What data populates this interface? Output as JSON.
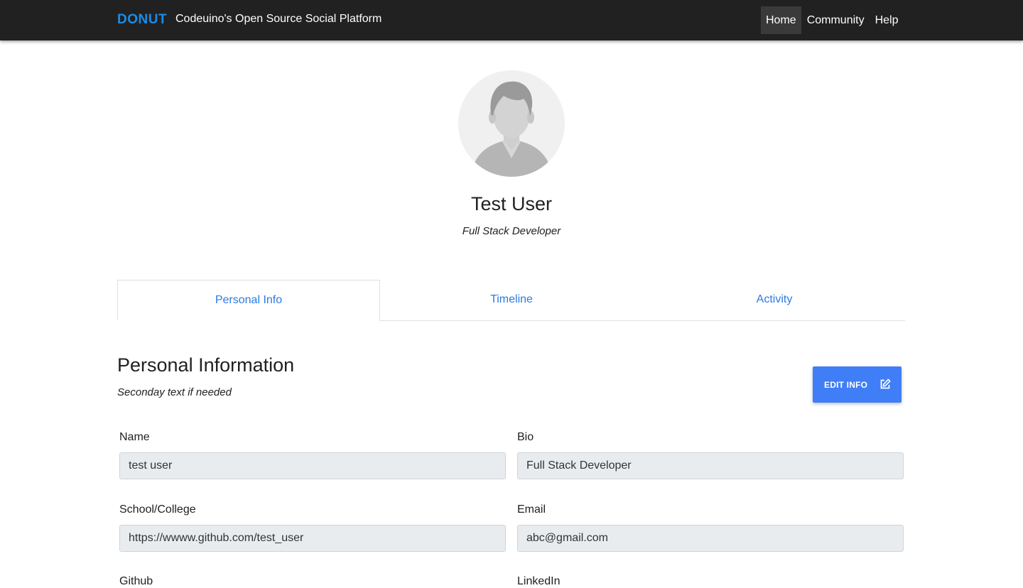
{
  "navbar": {
    "brand": "DONUT",
    "brand_color": "#1a8ce8",
    "tagline": "Codeuino's Open Source Social Platform",
    "links": [
      {
        "label": "Home",
        "active": true
      },
      {
        "label": "Community",
        "active": false
      },
      {
        "label": "Help",
        "active": false
      }
    ]
  },
  "profile": {
    "name": "Test User",
    "role": "Full Stack Developer",
    "avatar_icon": "default-user-avatar-icon"
  },
  "tabs": [
    {
      "label": "Personal Info",
      "active": true
    },
    {
      "label": "Timeline",
      "active": false
    },
    {
      "label": "Activity",
      "active": false
    }
  ],
  "section": {
    "title": "Personal Information",
    "subtitle": "Seconday text if needed",
    "edit_button": "EDIT INFO",
    "edit_icon": "edit-icon"
  },
  "fields": {
    "name": {
      "label": "Name",
      "value": "test user"
    },
    "bio": {
      "label": "Bio",
      "value": "Full Stack Developer"
    },
    "school": {
      "label": "School/College",
      "value": "https://wwww.github.com/test_user"
    },
    "email": {
      "label": "Email",
      "value": "abc@gmail.com"
    },
    "github": {
      "label": "Github"
    },
    "linkedin": {
      "label": "LinkedIn"
    }
  },
  "colors": {
    "navbar_bg": "#212121",
    "link_blue": "#2b7ae0",
    "button_blue": "#3f7ef6",
    "input_bg": "#e9ecef"
  }
}
